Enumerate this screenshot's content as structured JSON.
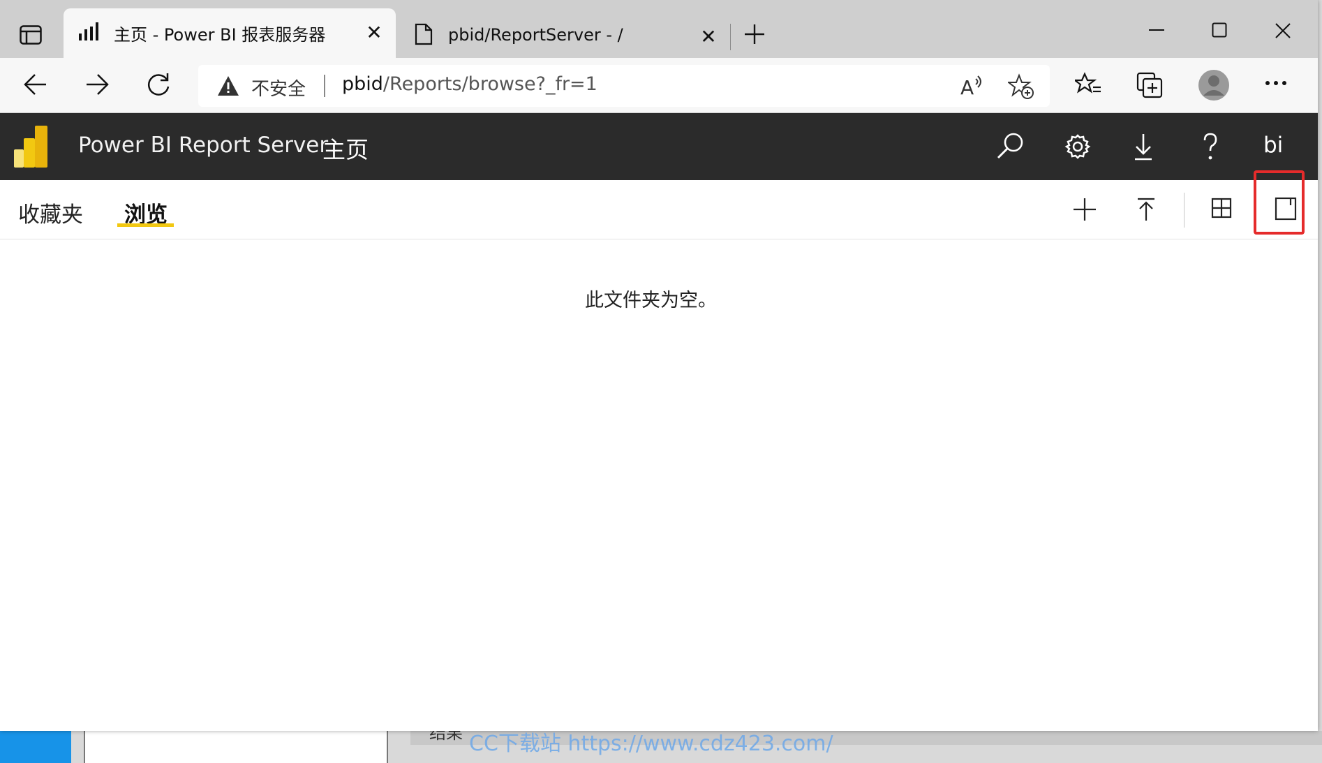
{
  "browser": {
    "tabs": [
      {
        "title": "主页 - Power BI 报表服务器",
        "icon": "bar-chart-icon"
      },
      {
        "title": "pbid/ReportServer - /",
        "icon": "document-icon"
      }
    ],
    "security_label": "不安全",
    "url_host": "pbid",
    "url_path": "/Reports/browse?_fr=1"
  },
  "app": {
    "title": "Power BI Report Server",
    "breadcrumb": "主页",
    "user_initials": "bi",
    "header_icons": [
      "search-icon",
      "settings-icon",
      "download-icon",
      "help-icon"
    ]
  },
  "subnav": {
    "tabs": [
      "收藏夹",
      "浏览"
    ],
    "active_tab": "浏览",
    "actions": [
      "new-icon",
      "upload-icon",
      "tile-view-icon",
      "details-pane-icon"
    ]
  },
  "content": {
    "empty_message": "此文件夹为空。"
  },
  "background": {
    "partial_text": "结果",
    "watermark": "CC下载站 https://www.cdz423.com/"
  },
  "colors": {
    "header_bg": "#2b2b2b",
    "accent_yellow": "#f2c811",
    "highlight_red": "#e52b2b"
  }
}
